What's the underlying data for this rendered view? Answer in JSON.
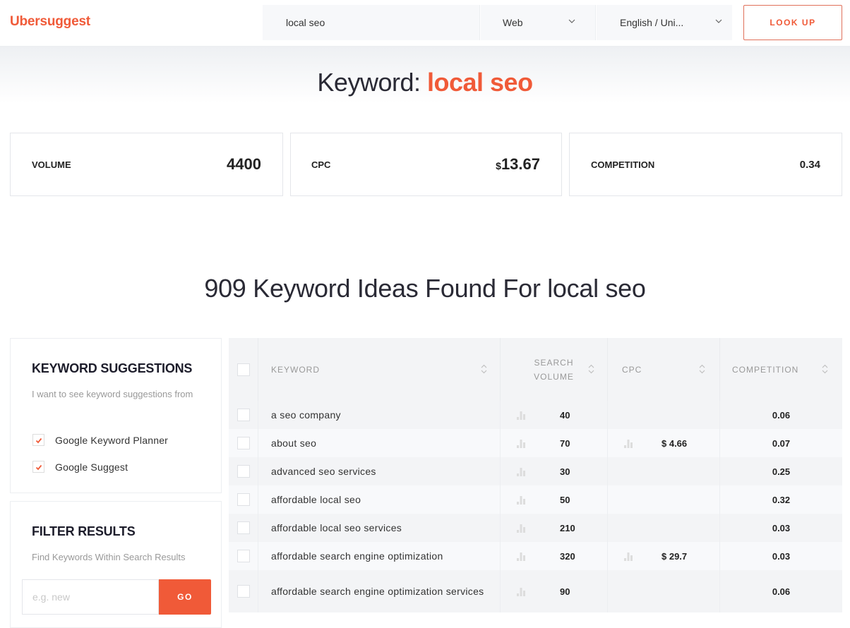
{
  "header": {
    "logo": "Ubersuggest",
    "search_value": "local seo",
    "source_select": "Web",
    "language_select": "English / Uni...",
    "lookup_label": "LOOK UP"
  },
  "keyword_heading": {
    "prefix": "Keyword:",
    "keyword": "local seo"
  },
  "metrics": {
    "volume": {
      "label": "VOLUME",
      "value": "4400"
    },
    "cpc": {
      "label": "CPC",
      "currency": "$",
      "value": "13.67"
    },
    "competition": {
      "label": "COMPETITION",
      "value": "0.34"
    }
  },
  "ideas_heading": "909 Keyword Ideas Found For local seo",
  "sidebar": {
    "suggestions": {
      "title": "KEYWORD SUGGESTIONS",
      "description": "I want to see keyword suggestions from",
      "options": [
        {
          "label": "Google Keyword Planner",
          "checked": true
        },
        {
          "label": "Google Suggest",
          "checked": true
        }
      ]
    },
    "filter": {
      "title": "FILTER RESULTS",
      "description": "Find Keywords Within Search Results",
      "placeholder": "e.g. new",
      "go_label": "GO"
    }
  },
  "table": {
    "columns": {
      "keyword": "KEYWORD",
      "volume_line1": "SEARCH",
      "volume_line2": "VOLUME",
      "cpc": "CPC",
      "competition": "COMPETITION"
    },
    "rows": [
      {
        "keyword": "a seo company",
        "volume": "40",
        "cpc": "",
        "competition": "0.06"
      },
      {
        "keyword": "about seo",
        "volume": "70",
        "cpc": "$ 4.66",
        "competition": "0.07"
      },
      {
        "keyword": "advanced seo services",
        "volume": "30",
        "cpc": "",
        "competition": "0.25"
      },
      {
        "keyword": "affordable local seo",
        "volume": "50",
        "cpc": "",
        "competition": "0.32"
      },
      {
        "keyword": "affordable local seo services",
        "volume": "210",
        "cpc": "",
        "competition": "0.03"
      },
      {
        "keyword": "affordable search engine optimization",
        "volume": "320",
        "cpc": "$ 29.7",
        "competition": "0.03"
      },
      {
        "keyword": "affordable search engine optimization services",
        "volume": "90",
        "cpc": "",
        "competition": "0.06"
      }
    ]
  },
  "colors": {
    "brand": "#f05a38",
    "text_dark": "#222222",
    "muted": "#999999"
  }
}
